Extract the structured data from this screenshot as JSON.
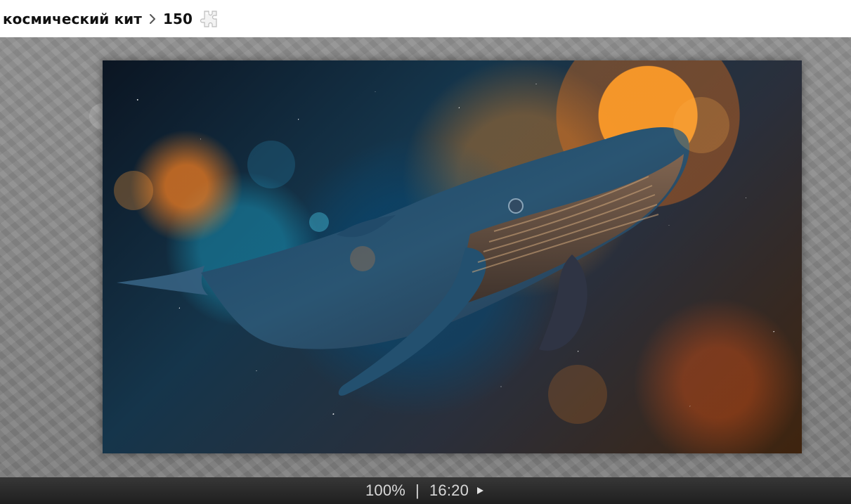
{
  "header": {
    "breadcrumb": {
      "title": "космический кит",
      "count": "150"
    }
  },
  "status": {
    "zoom": "100%",
    "divider": "|",
    "time": "16:20"
  },
  "icons": {
    "chevron": "chevron-right-icon",
    "puzzle": "puzzle-piece-icon",
    "play": "play-icon"
  },
  "colors": {
    "header_bg": "#ffffff",
    "viewer_bg": "#858585",
    "status_bg": "#262626",
    "status_text": "#d8d8d8"
  }
}
